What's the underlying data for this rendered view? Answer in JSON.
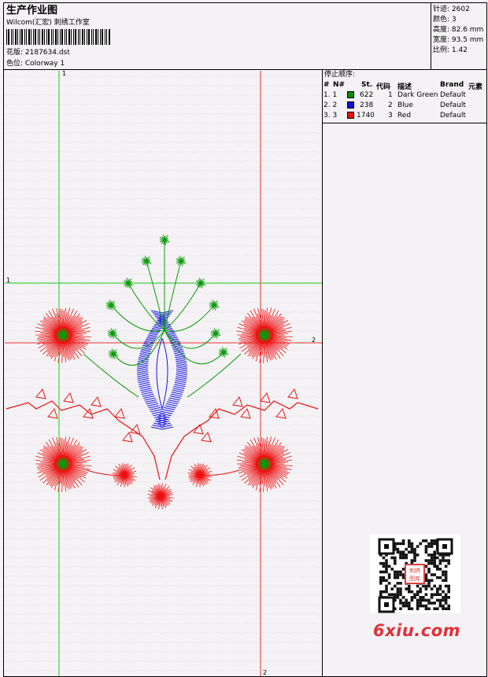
{
  "header": {
    "title": "生产作业图",
    "subtitle": "Wilcom(汇宏) 刺绣工作室",
    "design_file": "花版: 2187634.dst",
    "colorway": "色位: Colorway 1"
  },
  "stats": {
    "stitches": "针迹: 2602",
    "colors": "颜色: 3",
    "height": "高度: 82.6 mm",
    "width": "宽度: 93.5 mm",
    "ratio": "比例: 1.42"
  },
  "stop_sequence": {
    "title": "停止顺序:",
    "headers": [
      "#",
      "N#",
      "St.",
      "代码",
      "描述",
      "Brand",
      "元素"
    ],
    "rows": [
      {
        "idx": "1. 1",
        "color": "#0a8a0a",
        "stitches": "622",
        "code": "1",
        "desc": "Dark Green",
        "brand": "Default"
      },
      {
        "idx": "2. 2",
        "color": "#1010e0",
        "stitches": "238",
        "code": "2",
        "desc": "Blue",
        "brand": "Default"
      },
      {
        "idx": "3. 3",
        "color": "#e81010",
        "stitches": "1740",
        "code": "3",
        "desc": "Red",
        "brand": "Default"
      }
    ]
  },
  "guides": {
    "v1": "1",
    "h1": "1",
    "h2": "2",
    "v2": "2"
  },
  "colors": {
    "green": "#0a9a0a",
    "blue": "#1414e6",
    "red": "#ee1010",
    "guide_green": "#1ecb1e",
    "guide_red": "#e83030"
  },
  "watermark": {
    "text": "6xiu.com",
    "seal": "刺绣图库"
  }
}
